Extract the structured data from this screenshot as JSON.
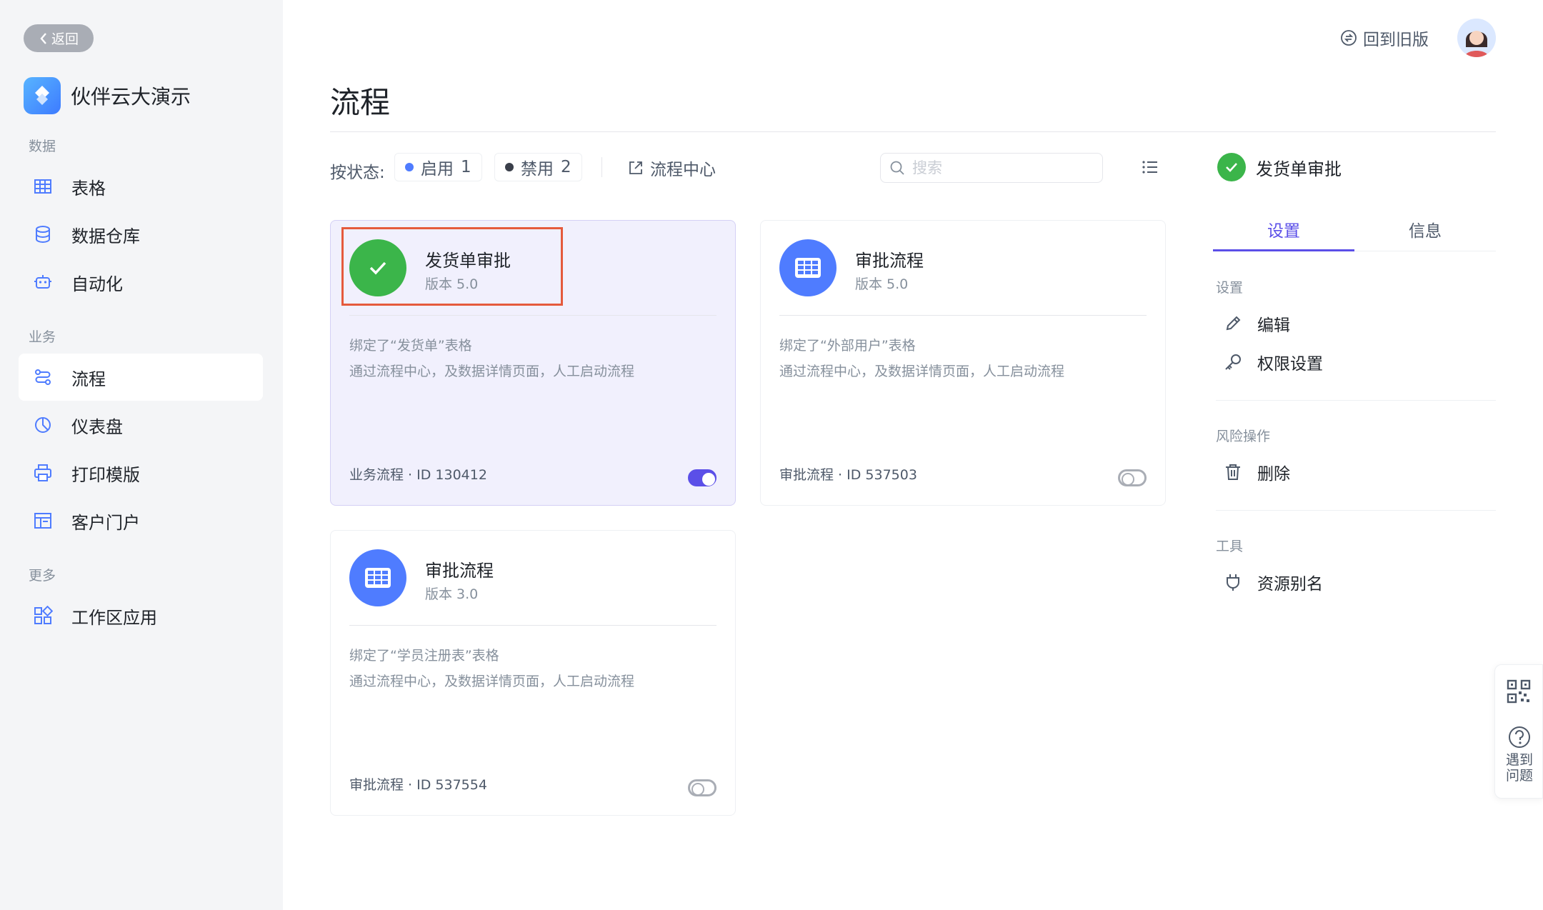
{
  "sidebar": {
    "back_label": "返回",
    "app_name": "伙伴云大演示",
    "app_logo_text": "伙伴云大演示",
    "groups": {
      "data": "数据",
      "business": "业务",
      "more": "更多"
    },
    "items": [
      {
        "label": "表格",
        "icon": "table-icon"
      },
      {
        "label": "数据仓库",
        "icon": "database-icon"
      },
      {
        "label": "自动化",
        "icon": "robot-icon"
      },
      {
        "label": "流程",
        "icon": "flow-icon",
        "active": true
      },
      {
        "label": "仪表盘",
        "icon": "dashboard-icon"
      },
      {
        "label": "打印模版",
        "icon": "printer-icon"
      },
      {
        "label": "客户门户",
        "icon": "portal-icon"
      },
      {
        "label": "工作区应用",
        "icon": "apps-icon"
      }
    ]
  },
  "topbar": {
    "old_version_label": "回到旧版"
  },
  "page": {
    "title": "流程"
  },
  "filters": {
    "label": "按状态:",
    "enabled": {
      "label": "启用",
      "count": "1",
      "color": "#4f7cff"
    },
    "disabled": {
      "label": "禁用",
      "count": "2",
      "color": "#3a3f4a"
    },
    "flow_center_label": "流程中心",
    "search_placeholder": "搜索"
  },
  "cards": [
    {
      "name": "发货单审批",
      "version": "版本 5.0",
      "bound": "绑定了“发货单”表格",
      "desc": "通过流程中心，及数据详情页面，人工启动流程",
      "footer": "业务流程 · ID 130412",
      "enabled": true,
      "icon": "check-icon",
      "icon_color": "#3bb54a"
    },
    {
      "name": "审批流程",
      "version": "版本 5.0",
      "bound": "绑定了“外部用户”表格",
      "desc": "通过流程中心，及数据详情页面，人工启动流程",
      "footer": "审批流程 · ID 537503",
      "enabled": false,
      "icon": "grid-icon",
      "icon_color": "#4f7cff"
    },
    {
      "name": "审批流程",
      "version": "版本 3.0",
      "bound": "绑定了“学员注册表”表格",
      "desc": "通过流程中心，及数据详情页面，人工启动流程",
      "footer": "审批流程 · ID 537554",
      "enabled": false,
      "icon": "grid-icon",
      "icon_color": "#4f7cff"
    }
  ],
  "panel": {
    "title": "发货单审批",
    "tabs": [
      {
        "label": "设置",
        "active": true
      },
      {
        "label": "信息",
        "active": false
      }
    ],
    "sections": {
      "settings": "设置",
      "risk": "风险操作",
      "tools": "工具"
    },
    "actions": {
      "edit": "编辑",
      "permissions": "权限设置",
      "delete": "删除",
      "alias": "资源别名"
    }
  },
  "float": {
    "help_label": "遇到问题"
  },
  "colors": {
    "accent": "#5b4fe8",
    "success": "#3bb54a",
    "primary_blue": "#4f7cff",
    "highlight_border": "#e55a3c"
  }
}
